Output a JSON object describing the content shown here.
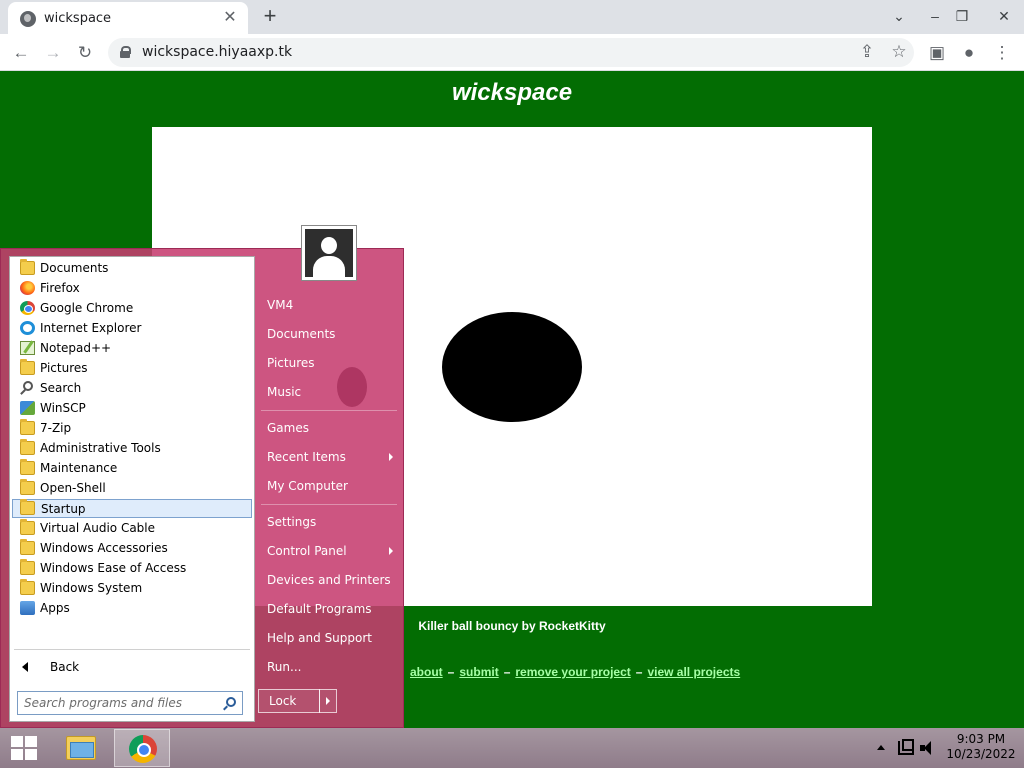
{
  "browser": {
    "tab_title": "wickspace",
    "tab_close": "✕",
    "new_tab": "+",
    "url": "wickspace.hiyaaxp.tk",
    "window_controls": {
      "chevron": "⌄",
      "minimize": "–",
      "restore": "❐",
      "close": "✕"
    },
    "toolbar_icons": {
      "back": "←",
      "forward": "→",
      "reload": "↻",
      "share": "⇪",
      "bookmark": "☆",
      "side_panel": "▣",
      "profile": "●",
      "menu": "⋮"
    }
  },
  "page": {
    "site_title": "wickspace",
    "project_caption": "Killer ball bouncy by RocketKitty",
    "footer_links": [
      "about",
      "submit",
      "remove your project",
      "view all projects"
    ],
    "footer_separator": "–"
  },
  "start_menu": {
    "programs": [
      {
        "label": "Documents",
        "icon": "documents-folder-icon"
      },
      {
        "label": "Firefox",
        "icon": "firefox-icon"
      },
      {
        "label": "Google Chrome",
        "icon": "chrome-icon"
      },
      {
        "label": "Internet Explorer",
        "icon": "internet-explorer-icon"
      },
      {
        "label": "Notepad++",
        "icon": "notepad-plus-plus-icon"
      },
      {
        "label": "Pictures",
        "icon": "pictures-folder-icon"
      },
      {
        "label": "Search",
        "icon": "search-icon"
      },
      {
        "label": "WinSCP",
        "icon": "winscp-icon"
      },
      {
        "label": "7-Zip",
        "icon": "folder-icon"
      },
      {
        "label": "Administrative Tools",
        "icon": "folder-icon"
      },
      {
        "label": "Maintenance",
        "icon": "folder-icon"
      },
      {
        "label": "Open-Shell",
        "icon": "folder-icon"
      },
      {
        "label": "Startup",
        "icon": "folder-icon",
        "selected": true
      },
      {
        "label": "Virtual Audio Cable",
        "icon": "folder-icon"
      },
      {
        "label": "Windows Accessories",
        "icon": "folder-icon"
      },
      {
        "label": "Windows Ease of Access",
        "icon": "folder-icon"
      },
      {
        "label": "Windows System",
        "icon": "folder-icon"
      },
      {
        "label": "Apps",
        "icon": "apps-icon"
      }
    ],
    "back_label": "Back",
    "search_placeholder": "Search programs and files",
    "right_items": [
      {
        "label": "VM4"
      },
      {
        "label": "Documents"
      },
      {
        "label": "Pictures"
      },
      {
        "label": "Music"
      },
      {
        "label": "Games"
      },
      {
        "label": "Recent Items",
        "submenu": true
      },
      {
        "label": "My Computer"
      },
      {
        "label": "Settings"
      },
      {
        "label": "Control Panel",
        "submenu": true
      },
      {
        "label": "Devices and Printers"
      },
      {
        "label": "Default Programs"
      },
      {
        "label": "Help and Support"
      },
      {
        "label": "Run..."
      }
    ],
    "lock_label": "Lock"
  },
  "taskbar": {
    "time": "9:03 PM",
    "date": "10/23/2022"
  },
  "colors": {
    "page_background": "#036d03",
    "start_menu_background": "#c63e70",
    "link_color": "#a6ffa6"
  }
}
